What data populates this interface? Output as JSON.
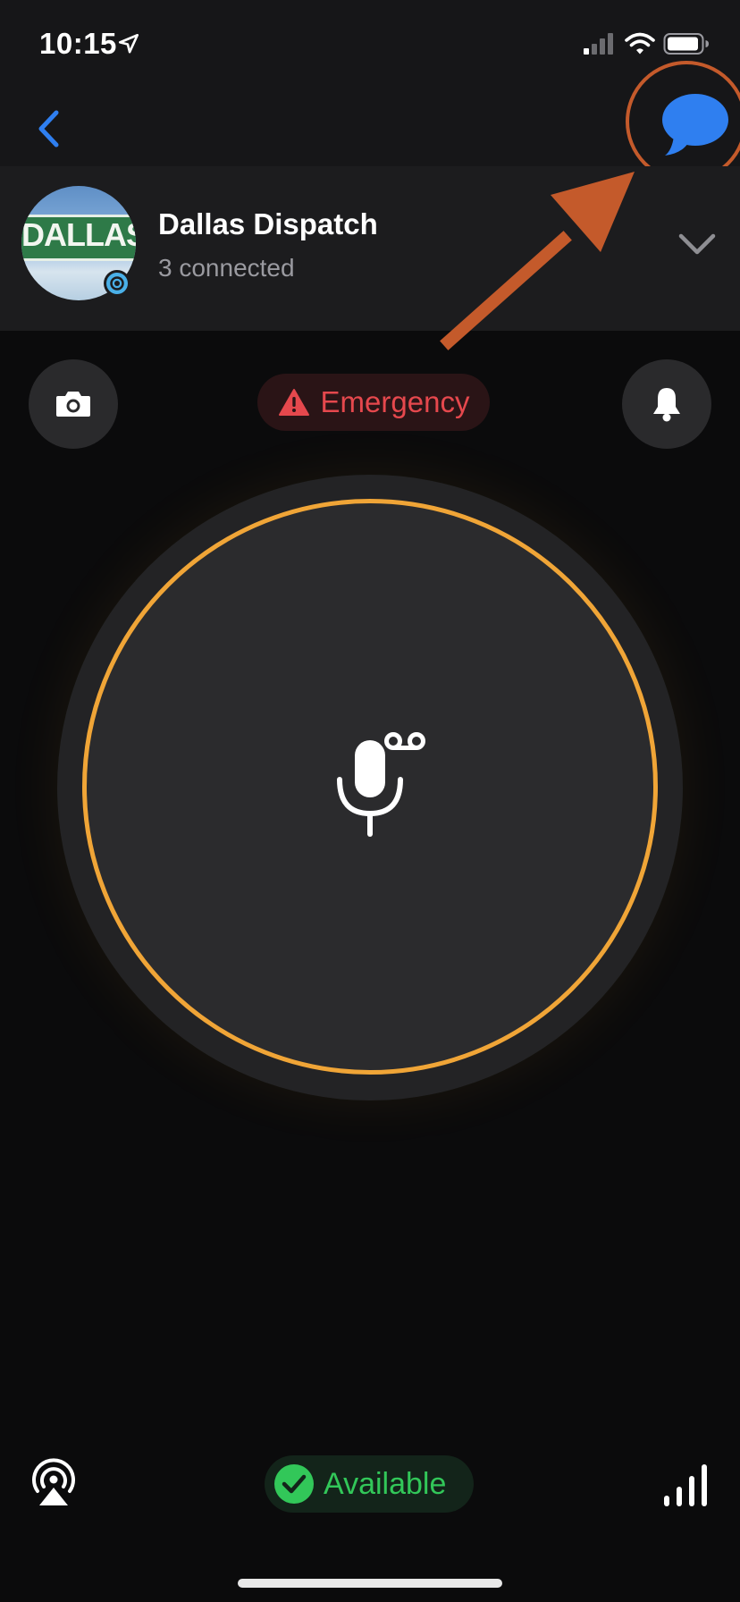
{
  "status_bar": {
    "time": "10:15"
  },
  "channel": {
    "name": "Dallas Dispatch",
    "connected": "3 connected",
    "avatar_text": "DALLAS"
  },
  "actions": {
    "emergency_label": "Emergency"
  },
  "footer": {
    "availability_label": "Available"
  },
  "colors": {
    "accent_blue": "#2f7ff0",
    "ptt_ring": "#f0a537",
    "emergency_red": "#e5484d",
    "available_green": "#32c759",
    "annotation_orange": "#c45a2b"
  },
  "icons": {
    "status": [
      "location-arrow-icon",
      "cellular-signal-icon",
      "wifi-icon",
      "battery-icon"
    ],
    "nav": [
      "back-chevron-icon",
      "chat-bubble-icon"
    ],
    "channel": [
      "online-badge-icon",
      "chevron-down-icon"
    ],
    "actions": [
      "camera-icon",
      "warning-triangle-icon",
      "bell-icon",
      "microphone-voicemail-icon"
    ],
    "footer": [
      "airplay-icon",
      "checkmark-icon",
      "signal-bars-icon"
    ]
  }
}
